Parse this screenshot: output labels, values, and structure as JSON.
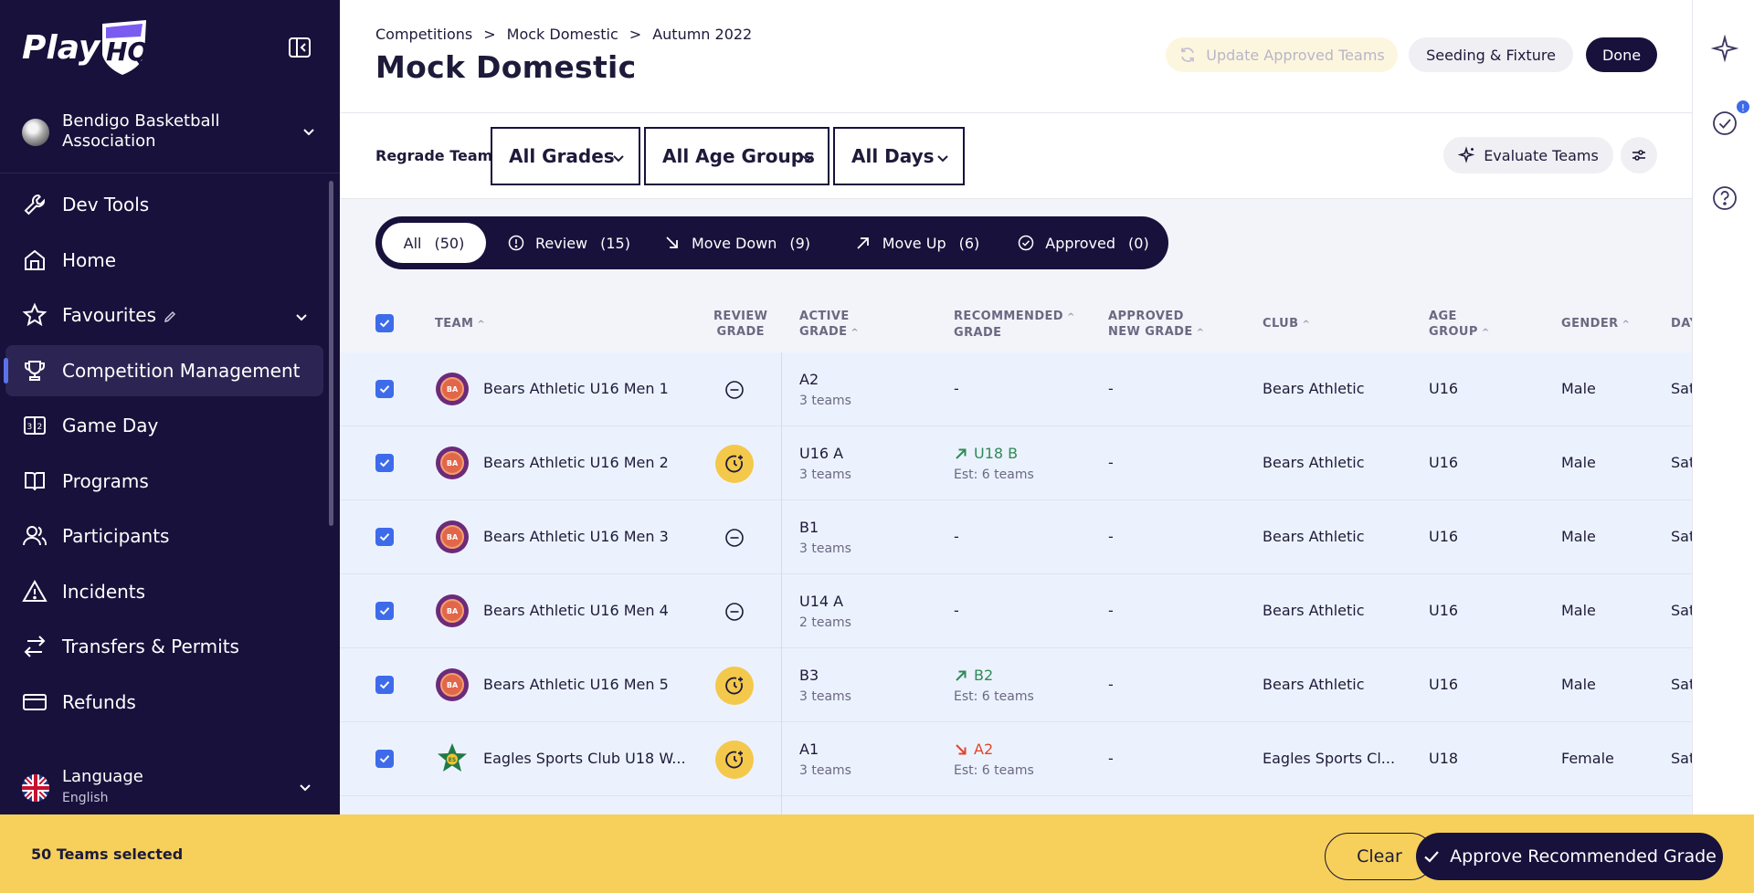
{
  "app": {
    "logo_text": "PlayHQ"
  },
  "sidebar": {
    "org_name": "Bendigo Basketball Association",
    "items": [
      {
        "label": "Dev Tools",
        "icon": "wrench-icon"
      },
      {
        "label": "Home",
        "icon": "home-icon"
      },
      {
        "label": "Favourites",
        "icon": "star-icon"
      },
      {
        "label": "Competition Management",
        "icon": "trophy-icon"
      },
      {
        "label": "Game Day",
        "icon": "scoreboard-icon"
      },
      {
        "label": "Programs",
        "icon": "book-icon"
      },
      {
        "label": "Participants",
        "icon": "users-icon"
      },
      {
        "label": "Incidents",
        "icon": "warning-icon"
      },
      {
        "label": "Transfers & Permits",
        "icon": "transfer-icon"
      },
      {
        "label": "Refunds",
        "icon": "card-icon"
      }
    ],
    "language_label": "Language",
    "language_value": "English"
  },
  "header": {
    "breadcrumb": [
      "Competitions",
      "Mock Domestic",
      "Autumn 2022"
    ],
    "title": "Mock Domestic",
    "update_label": "Update Approved Teams",
    "seeding_label": "Seeding & Fixture",
    "done_label": "Done"
  },
  "filters": {
    "regrade_label": "Regrade Teams",
    "grades": "All Grades",
    "age_groups": "All Age Groups",
    "days": "All Days",
    "evaluate_label": "Evaluate Teams"
  },
  "segments": [
    {
      "label": "All",
      "count": "(50)"
    },
    {
      "label": "Review",
      "count": "(15)"
    },
    {
      "label": "Move Down",
      "count": "(9)"
    },
    {
      "label": "Move Up",
      "count": "(6)"
    },
    {
      "label": "Approved",
      "count": "(0)"
    }
  ],
  "table": {
    "headers": {
      "team": "TEAM",
      "review_grade": [
        "REVIEW",
        "GRADE"
      ],
      "active_grade": [
        "ACTIVE",
        "GRADE"
      ],
      "recommended_grade": [
        "RECOMMENDED",
        "GRADE"
      ],
      "approved_new_grade": [
        "APPROVED",
        "NEW GRADE"
      ],
      "club": "CLUB",
      "age_group": [
        "AGE",
        "GROUP"
      ],
      "gender": "GENDER",
      "day": "DAY"
    },
    "rows": [
      {
        "team": "Bears Athletic U16 Men 1",
        "badge": "BA",
        "review": "neutral",
        "active": "A2",
        "active_sub": "3 teams",
        "rec": "-",
        "rec_dir": "",
        "rec_sub": "",
        "approved": "-",
        "club": "Bears Athletic",
        "age": "U16",
        "gender": "Male",
        "day": "Sat"
      },
      {
        "team": "Bears Athletic U16 Men 2",
        "badge": "BA",
        "review": "pending",
        "active": "U16 A",
        "active_sub": "3 teams",
        "rec": "U18 B",
        "rec_dir": "up",
        "rec_sub": "Est: 6 teams",
        "approved": "-",
        "club": "Bears Athletic",
        "age": "U16",
        "gender": "Male",
        "day": "Sat"
      },
      {
        "team": "Bears Athletic U16 Men 3",
        "badge": "BA",
        "review": "neutral",
        "active": "B1",
        "active_sub": "3 teams",
        "rec": "-",
        "rec_dir": "",
        "rec_sub": "",
        "approved": "-",
        "club": "Bears Athletic",
        "age": "U16",
        "gender": "Male",
        "day": "Sat"
      },
      {
        "team": "Bears Athletic U16 Men 4",
        "badge": "BA",
        "review": "neutral",
        "active": "U14 A",
        "active_sub": "2 teams",
        "rec": "-",
        "rec_dir": "",
        "rec_sub": "",
        "approved": "-",
        "club": "Bears Athletic",
        "age": "U16",
        "gender": "Male",
        "day": "Sat"
      },
      {
        "team": "Bears Athletic U16 Men 5",
        "badge": "BA",
        "review": "pending",
        "active": "B3",
        "active_sub": "3 teams",
        "rec": "B2",
        "rec_dir": "up",
        "rec_sub": "Est: 6 teams",
        "approved": "-",
        "club": "Bears Athletic",
        "age": "U16",
        "gender": "Male",
        "day": "Sat"
      },
      {
        "team": "Eagles Sports Club U18 W...",
        "badge": "ES",
        "review": "pending",
        "active": "A1",
        "active_sub": "3 teams",
        "rec": "A2",
        "rec_dir": "down",
        "rec_sub": "Est: 6 teams",
        "approved": "-",
        "club": "Eagles Sports Cl...",
        "age": "U18",
        "gender": "Female",
        "day": "Sat"
      }
    ]
  },
  "bottom_bar": {
    "selected_text": "50 Teams selected",
    "clear_label": "Clear",
    "approve_label": "Approve Recommended Grade"
  },
  "colors": {
    "sidebar": "#17113b",
    "accent": "#3d6bea",
    "bar": "#f6d05a",
    "up": "#2e8b57",
    "down": "#e0452c"
  }
}
